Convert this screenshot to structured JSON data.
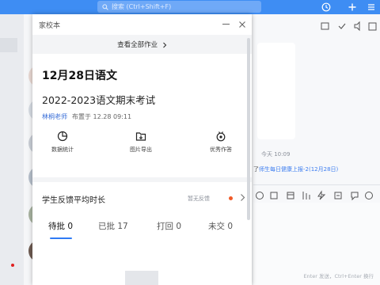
{
  "app": {
    "search_placeholder": "搜索 (Ctrl+Shift+F)"
  },
  "modal": {
    "title": "家校本",
    "view_all": "查看全部作业",
    "date_subject": "12月28日语文",
    "assignment_title": "2022-2023语文期末考试",
    "teacher": "林桐老师",
    "posted": "布置于 12.28 09:11",
    "actions": [
      {
        "label": "数据统计",
        "icon": "data-stats-icon"
      },
      {
        "label": "图片导出",
        "icon": "image-export-icon"
      },
      {
        "label": "优秀作答",
        "icon": "excellent-answer-icon"
      }
    ],
    "feedback": {
      "label": "学生反馈平均时长",
      "status": "暂无反馈",
      "dot_color": "#f05a28"
    },
    "tabs": [
      {
        "label": "待批 0"
      },
      {
        "label": "已批 17"
      },
      {
        "label": "打回 0"
      },
      {
        "label": "未交 0"
      }
    ]
  },
  "chat": {
    "time": "今天 10:09",
    "notice_prefix": "了",
    "notice_link": "师生每日健康上报-2(12月28日)",
    "input_hint": "Enter 发送，Ctrl+Enter 换行"
  },
  "colors": {
    "titlebar": "#3e8df3",
    "accent": "#2f7bf5",
    "link": "#3e7ef0"
  }
}
